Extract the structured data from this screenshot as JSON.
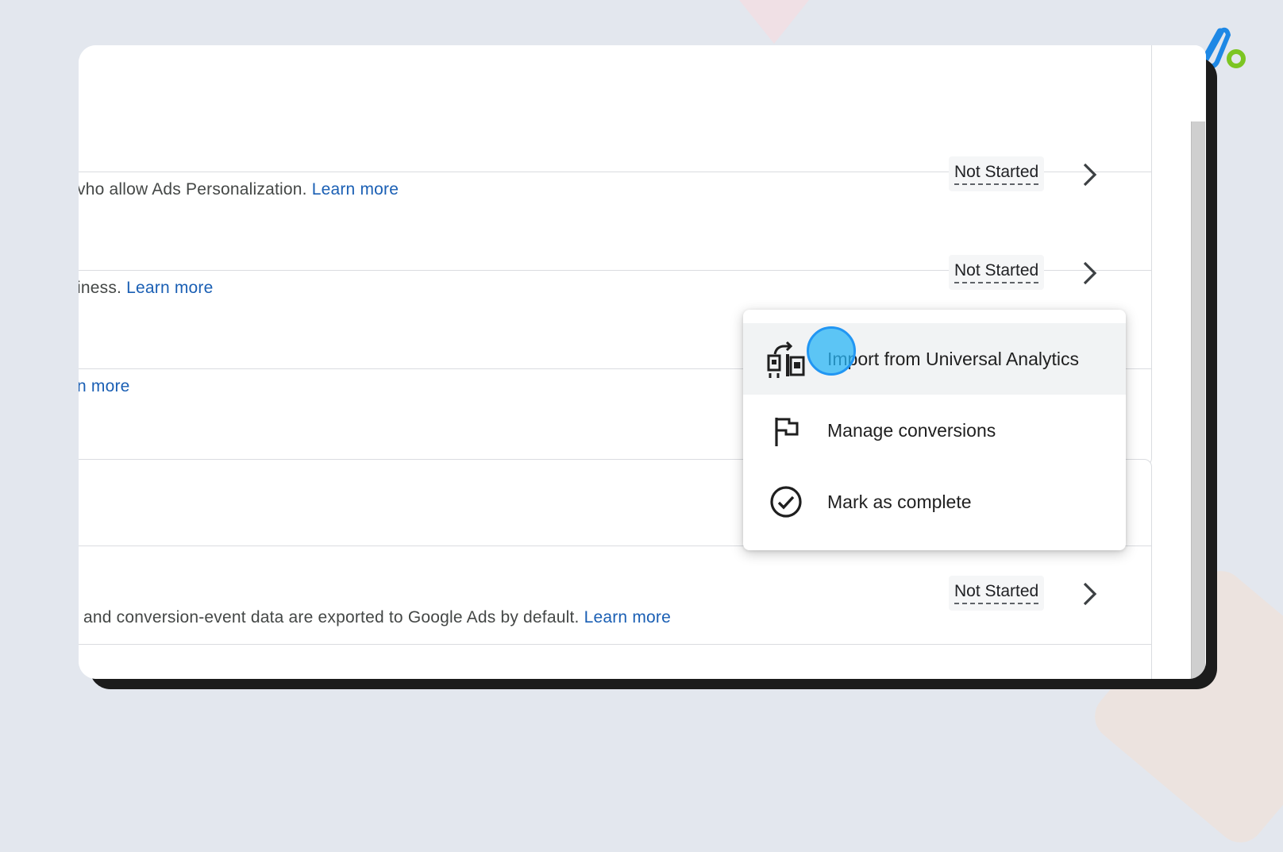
{
  "rows": [
    {
      "desc": "vho allow Ads Personalization.",
      "link": "Learn more",
      "status": "Not Started"
    },
    {
      "desc": "iness.",
      "link": "Learn more",
      "status": "Not Started"
    },
    {
      "desc": "",
      "link": "n more",
      "status": ""
    },
    {
      "desc": "and conversion-event data are exported to Google Ads by default.",
      "link": "Learn more",
      "status": "Not Started"
    }
  ],
  "menu": {
    "items": [
      {
        "label": "Import from Universal Analytics",
        "icon": "import-icon"
      },
      {
        "label": "Manage conversions",
        "icon": "flag-icon"
      },
      {
        "label": "Mark as complete",
        "icon": "check-circle-icon"
      }
    ]
  },
  "colors": {
    "link": "#1a5fb4",
    "hover_bg": "#f1f3f4",
    "click_indicator": "#29b6f6"
  }
}
